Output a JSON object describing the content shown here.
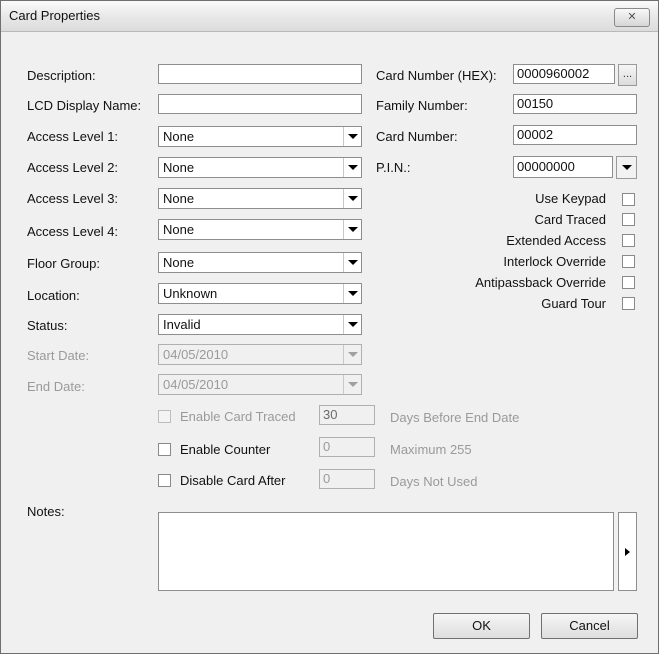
{
  "window": {
    "title": "Card Properties",
    "close_label": "✕"
  },
  "left": {
    "description_label": "Description:",
    "description_value": "",
    "lcd_label": "LCD Display Name:",
    "lcd_value": "",
    "access1_label": "Access Level 1:",
    "access1_value": "None",
    "access2_label": "Access Level 2:",
    "access2_value": "None",
    "access3_label": "Access Level 3:",
    "access3_value": "None",
    "access4_label": "Access Level 4:",
    "access4_value": "None",
    "floor_label": "Floor Group:",
    "floor_value": "None",
    "location_label": "Location:",
    "location_value": "Unknown",
    "status_label": "Status:",
    "status_value": "Invalid",
    "start_label": "Start Date:",
    "start_value": "04/05/2010",
    "end_label": "End Date:",
    "end_value": "04/05/2010"
  },
  "right": {
    "card_hex_label": "Card Number (HEX):",
    "card_hex_value": "0000960002",
    "browse_label": "...",
    "family_label": "Family Number:",
    "family_value": "00150",
    "card_number_label": "Card Number:",
    "card_number_value": "00002",
    "pin_label": "P.I.N.:",
    "pin_value": "00000000",
    "checks": {
      "use_keypad": "Use Keypad",
      "card_traced": "Card Traced",
      "extended_access": "Extended Access",
      "interlock_override": "Interlock Override",
      "antipassback_override": "Antipassback Override",
      "guard_tour": "Guard Tour"
    }
  },
  "options": {
    "enable_traced_label": "Enable Card Traced",
    "enable_traced_value": "30",
    "enable_traced_suffix": "Days Before End Date",
    "enable_counter_label": "Enable Counter",
    "enable_counter_value": "0",
    "enable_counter_suffix": "Maximum 255",
    "disable_after_label": "Disable Card After",
    "disable_after_value": "0",
    "disable_after_suffix": "Days Not Used"
  },
  "notes": {
    "label": "Notes:",
    "value": ""
  },
  "buttons": {
    "ok": "OK",
    "cancel": "Cancel"
  }
}
